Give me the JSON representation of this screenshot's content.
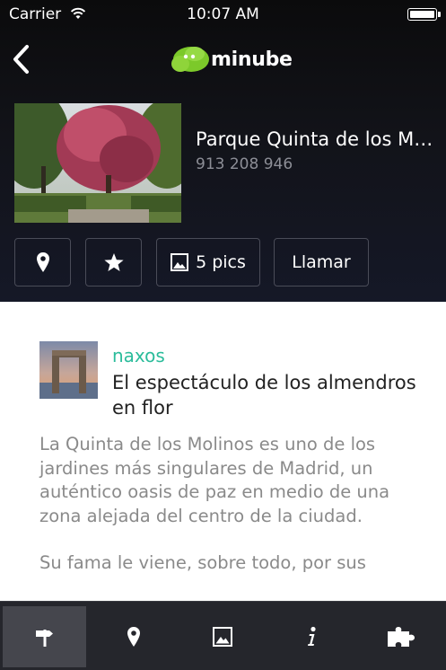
{
  "status_bar": {
    "carrier": "Carrier",
    "time": "10:07 AM"
  },
  "nav": {
    "brand": "minube",
    "back_icon": "chevron-left-icon"
  },
  "place": {
    "name": "Parque Quinta de los Molinos",
    "phone": "913 208 946"
  },
  "actions": {
    "map_icon": "map-pin-icon",
    "favorite_icon": "star-icon",
    "pics_label": "5 pics",
    "call_label": "Llamar"
  },
  "review": {
    "author": "naxos",
    "title": "El espectáculo de los almendros en flor",
    "paragraphs": [
      "La Quinta de los Molinos es uno de los jardines más singulares de Madrid, un auténtico oasis de paz en medio de una zona alejada del centro de la ciudad.",
      "Su fama le viene, sobre todo, por sus"
    ]
  },
  "tabbar": {
    "items": [
      {
        "icon": "signpost-icon",
        "active": true
      },
      {
        "icon": "map-pin-icon",
        "active": false
      },
      {
        "icon": "picture-icon",
        "active": false
      },
      {
        "icon": "info-icon",
        "active": false
      },
      {
        "icon": "puzzle-icon",
        "active": false
      }
    ]
  },
  "colors": {
    "accent": "#2bbc9b",
    "brand_green": "#7cc92a",
    "tabbar_bg": "#25262c",
    "header_bg": "#121319"
  }
}
